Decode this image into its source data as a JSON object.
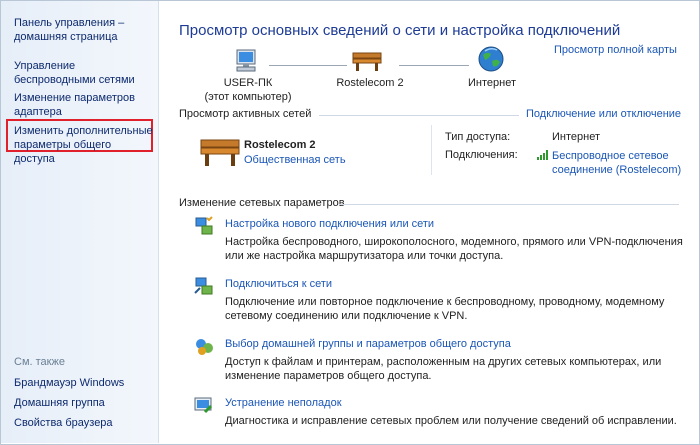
{
  "sidebar": {
    "home": "Панель управления – домашняя страница",
    "wireless": "Управление беспроводными сетями",
    "adapter": "Изменение параметров адаптера",
    "advanced_sharing": "Изменить дополнительные параметры общего доступа",
    "see_also_label": "См. также",
    "see_also": [
      "Брандмауэр Windows",
      "Домашняя группа",
      "Свойства браузера"
    ]
  },
  "main": {
    "title": "Просмотр основных сведений о сети и настройка подключений",
    "full_map": "Просмотр полной карты",
    "nodes": {
      "computer": "USER-ПК",
      "computer_sub": "(этот компьютер)",
      "network": "Rostelecom  2",
      "internet": "Интернет"
    },
    "active_networks": {
      "heading": "Просмотр активных сетей",
      "connect_link": "Подключение или отключение",
      "name": "Rostelecom  2",
      "type": "Общественная сеть",
      "access_label": "Тип доступа:",
      "access_value": "Интернет",
      "connections_label": "Подключения:",
      "connections_value": "Беспроводное сетевое соединение (Rostelecom)"
    },
    "change_settings": {
      "heading": "Изменение сетевых параметров",
      "tasks": [
        {
          "title": "Настройка нового подключения или сети",
          "desc": "Настройка беспроводного, широкополосного, модемного, прямого или VPN-подключения или же настройка маршрутизатора или точки доступа."
        },
        {
          "title": "Подключиться к сети",
          "desc": "Подключение или повторное подключение к беспроводному, проводному, модемному сетевому соединению или подключение к VPN."
        },
        {
          "title": "Выбор домашней группы и параметров общего доступа",
          "desc": "Доступ к файлам и принтерам, расположенным на других сетевых компьютерах, или изменение параметров общего доступа."
        },
        {
          "title": "Устранение неполадок",
          "desc": "Диагностика и исправление сетевых проблем или получение сведений об исправлении."
        }
      ]
    }
  },
  "colors": {
    "link": "#1a56b6",
    "title": "#1e3c96",
    "highlight": "#e0202a"
  }
}
